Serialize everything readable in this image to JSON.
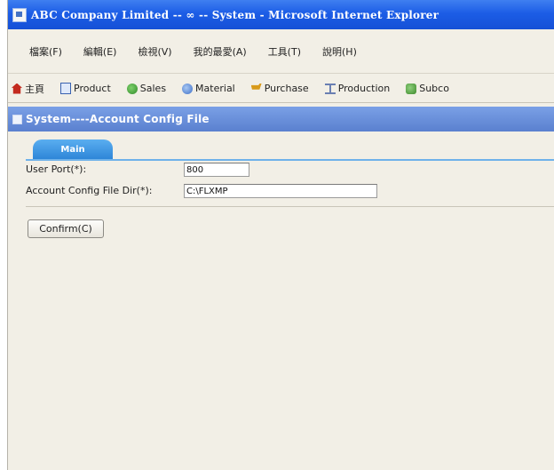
{
  "window": {
    "title": "ABC Company Limited -- ∞ -- System - Microsoft Internet Explorer"
  },
  "menubar": {
    "items": [
      "檔案(F)",
      "編輯(E)",
      "檢視(V)",
      "我的最愛(A)",
      "工具(T)",
      "說明(H)"
    ]
  },
  "toolbar": {
    "items": [
      {
        "label": "主頁",
        "icon": "home-icon"
      },
      {
        "label": "Product",
        "icon": "product-icon"
      },
      {
        "label": "Sales",
        "icon": "sales-icon"
      },
      {
        "label": "Material",
        "icon": "material-icon"
      },
      {
        "label": "Purchase",
        "icon": "purchase-icon"
      },
      {
        "label": "Production",
        "icon": "production-icon"
      },
      {
        "label": "Subco",
        "icon": "subcon-icon"
      }
    ]
  },
  "page": {
    "title": "System----Account Config File"
  },
  "tabs": [
    {
      "label": "Main"
    }
  ],
  "form": {
    "user_port_label": "User Port(*):",
    "user_port_value": "800",
    "config_dir_label": "Account Config File Dir(*):",
    "config_dir_value": "C:\\FLXMP"
  },
  "actions": {
    "confirm_label": "Confirm(C)"
  },
  "colors": {
    "titlebar": "#1c5de6",
    "pagebar": "#5a80cf",
    "tab": "#2e86d8",
    "background": "#f2efe6"
  }
}
